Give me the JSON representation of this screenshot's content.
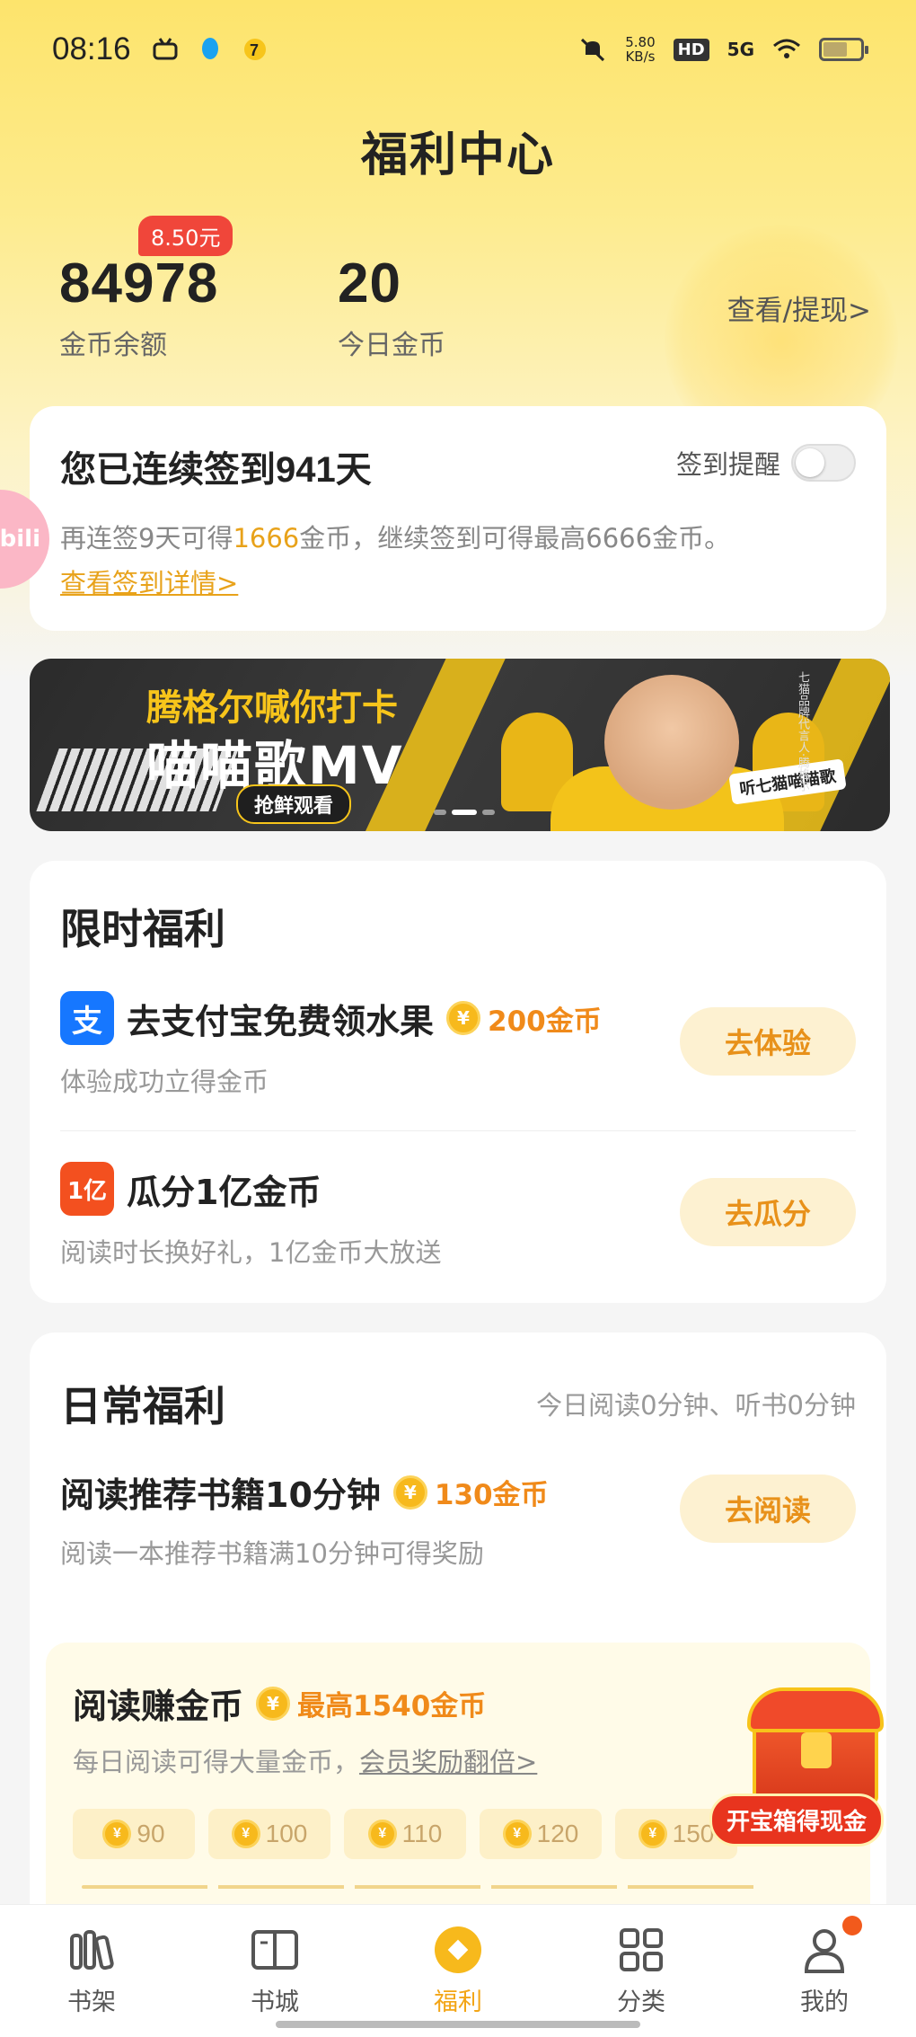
{
  "status_bar": {
    "time": "08:16",
    "net_speed_value": "5.80",
    "net_speed_unit": "KB/s",
    "hd": "HD",
    "network": "5G"
  },
  "page": {
    "title": "福利中心"
  },
  "balance": {
    "coins": "84978",
    "coins_label": "金币余额",
    "cash_badge": "8.50元",
    "today_coins": "20",
    "today_label": "今日金币",
    "withdraw_link": "查看/提现>"
  },
  "signin": {
    "title_prefix": "您已连续签到",
    "days": "941",
    "title_suffix": "天",
    "reminder_label": "签到提醒",
    "reminder_on": false,
    "desc_prefix": "再连签9天可得",
    "desc_highlight": "1666",
    "desc_suffix": "金币，继续签到可得最高6666金币。",
    "detail_link": "查看签到详情>"
  },
  "floating_badge": {
    "text": "bili"
  },
  "banner": {
    "line1": "腾格尔喊你打卡",
    "line2": "喵喵歌MV",
    "cta": "抢鲜观看",
    "tagline": "听七猫喵喵歌",
    "vertical": "七猫品牌代言人·腾格尔"
  },
  "limited": {
    "title": "限时福利",
    "tasks": [
      {
        "name": "去支付宝免费领水果",
        "reward": "200金币",
        "sub": "体验成功立得金币",
        "button": "去体验",
        "logo": "支"
      },
      {
        "name": "瓜分1亿金币",
        "reward": "",
        "sub": "阅读时长换好礼，1亿金币大放送",
        "button": "去瓜分",
        "logo": "1亿"
      }
    ]
  },
  "daily": {
    "title": "日常福利",
    "note": "今日阅读0分钟、听书0分钟",
    "tasks": [
      {
        "name": "阅读推荐书籍10分钟",
        "reward": "130金币",
        "sub": "阅读一本推荐书籍满10分钟可得奖励",
        "button": "去阅读"
      }
    ],
    "earn": {
      "name": "阅读赚金币",
      "reward": "最高1540金币",
      "sub_prefix": "每日阅读可得大量金币，",
      "sub_link": "会员奖励翻倍>",
      "milestones": [
        "90",
        "100",
        "110",
        "120",
        "150"
      ]
    }
  },
  "treasure": {
    "label": "开宝箱得现金"
  },
  "tab_bar": {
    "items": [
      {
        "label": "书架",
        "icon": "bookshelf-icon"
      },
      {
        "label": "书城",
        "icon": "book-open-icon"
      },
      {
        "label": "福利",
        "icon": "welfare-diamond-icon"
      },
      {
        "label": "分类",
        "icon": "grid-icon"
      },
      {
        "label": "我的",
        "icon": "user-icon"
      }
    ],
    "active_index": 2
  },
  "colors": {
    "accent": "#f3a516",
    "badge_red": "#f0463a",
    "coin": "#f7b91c"
  }
}
